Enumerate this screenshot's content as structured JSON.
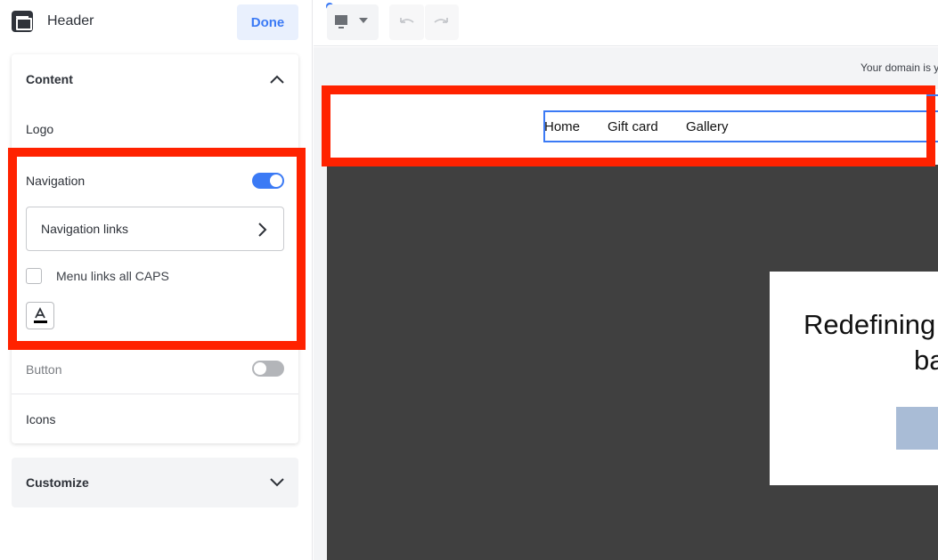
{
  "panel": {
    "title": "Header",
    "done_label": "Done",
    "content": {
      "title": "Content",
      "logo": "Logo",
      "navigation": "Navigation",
      "navigation_enabled": true,
      "navigation_links": "Navigation links",
      "caps_label": "Menu links all CAPS",
      "caps_checked": false,
      "button": "Button",
      "button_enabled": false,
      "icons": "Icons"
    },
    "customize": "Customize"
  },
  "toolbar": {
    "device": "desktop",
    "undo": "undo",
    "redo": "redo"
  },
  "preview": {
    "domain_notice": "Your domain is y",
    "nav_links": [
      "Home",
      "Gift card",
      "Gallery"
    ],
    "hero_line1": "Redefining",
    "hero_line2": "ba"
  },
  "colors": {
    "accent": "#3b7af5",
    "highlight": "#ff2200",
    "hero_bg": "#404040"
  }
}
